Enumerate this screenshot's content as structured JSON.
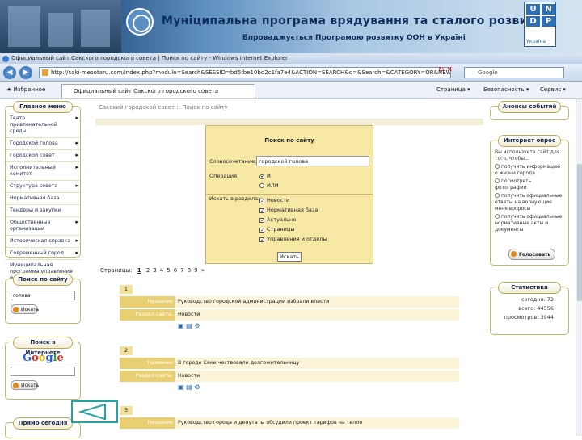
{
  "banner": {
    "title": "Муніципальна програма врядування та сталого розвитку",
    "subtitle": "Впроваджується Програмою розвитку ООН в Україні",
    "undp_letters": [
      "U",
      "N",
      "D",
      "P"
    ],
    "undp_caption": "Україна"
  },
  "browser": {
    "window_title": "Официальный сайт Сакского городского совета | Поиск по сайту - Windows Internet Explorer",
    "url": "http://saki-mesotaru.com/index.php?module=Search&SESSID=bd5fbe10bd2c1fa7e4&ACTION=SEARCH&q=&Search=&CATEGORY=OR&NEWS=1&CALVIEW=1&DAY=&WEEK=&AT=1",
    "search_placeholder": "Google",
    "favorites_label": "Избранное",
    "tab_label": "Официальный сайт Сакского городского совета",
    "toolbar_items": [
      "Страница ▾",
      "Безопасность ▾",
      "Сервис ▾"
    ]
  },
  "breadcrumb": "Сакский городской совет :: Поиск по сайту",
  "left": {
    "main_menu_title": "Главное меню",
    "menu_items": [
      {
        "label": "Театр привлекательной среды",
        "arrow": true
      },
      {
        "label": "Городской голова",
        "arrow": true
      },
      {
        "label": "Городской совет",
        "arrow": true
      },
      {
        "label": "Исполнительный комитет",
        "arrow": true
      },
      {
        "label": "Структура совета",
        "arrow": true
      },
      {
        "label": "Нормативная база",
        "arrow": false
      },
      {
        "label": "Тендеры и закупки",
        "arrow": false
      },
      {
        "label": "Общественные организации",
        "arrow": true
      },
      {
        "label": "Историческая справка",
        "arrow": true
      },
      {
        "label": "Современный город",
        "arrow": true
      },
      {
        "label": "Муниципальная программа управления и устойчивого развития",
        "arrow": false
      }
    ],
    "site_search_title": "Поиск по сайту",
    "site_search_value": "голова",
    "site_search_button": "Искать",
    "web_search_title": "Поиск в Интернете",
    "google_label": "Google",
    "web_search_button": "Искать",
    "bottom_box_title": "Прямо сегодня"
  },
  "form": {
    "heading": "Поиск по сайту",
    "keyword_label": "Словосочетание:",
    "keyword_value": "городской голова",
    "operation_label": "Операция:",
    "op_and": "И",
    "op_or": "ИЛИ",
    "sections_label": "Искать в разделах:",
    "sections": [
      "Новости",
      "Нормативная база",
      "Актуально",
      "Страницы",
      "Управления и отделы"
    ],
    "button": "Искать"
  },
  "pagination": {
    "label": "Страницы:",
    "current": "1",
    "pages": [
      "2",
      "3",
      "4",
      "5",
      "6",
      "7",
      "8",
      "9",
      "»"
    ]
  },
  "results": [
    {
      "num": "1",
      "page_label": "Название страницы:",
      "page_value": "Руководство городской администрации избрали власти",
      "section_label": "Раздел сайта:",
      "section_value": "Новости"
    },
    {
      "num": "2",
      "page_label": "Название страницы:",
      "page_value": "В городе Саки чествовали долгожительницу",
      "section_label": "Раздел сайта:",
      "section_value": "Новости"
    },
    {
      "num": "3",
      "page_label": "Название страницы:",
      "page_value": "Руководство города и депутаты обсудили проект тарифов на тепло",
      "section_label": "",
      "section_value": ""
    }
  ],
  "right": {
    "events_title": "Анонсы событий",
    "poll_title": "Интернет опрос",
    "poll_question": "Вы используете сайт для того, чтобы...",
    "poll_options": [
      "получить информацию о жизни города",
      "посмотреть фотографии",
      "получить официальные ответы на волнующие меня вопросы",
      "получить официальные нормативные акты и документы"
    ],
    "vote_button": "Голосовать",
    "stats_title": "Статистика",
    "stats": [
      "сегодня: 72",
      "всего: 44556",
      "просмотров: 3944"
    ]
  }
}
